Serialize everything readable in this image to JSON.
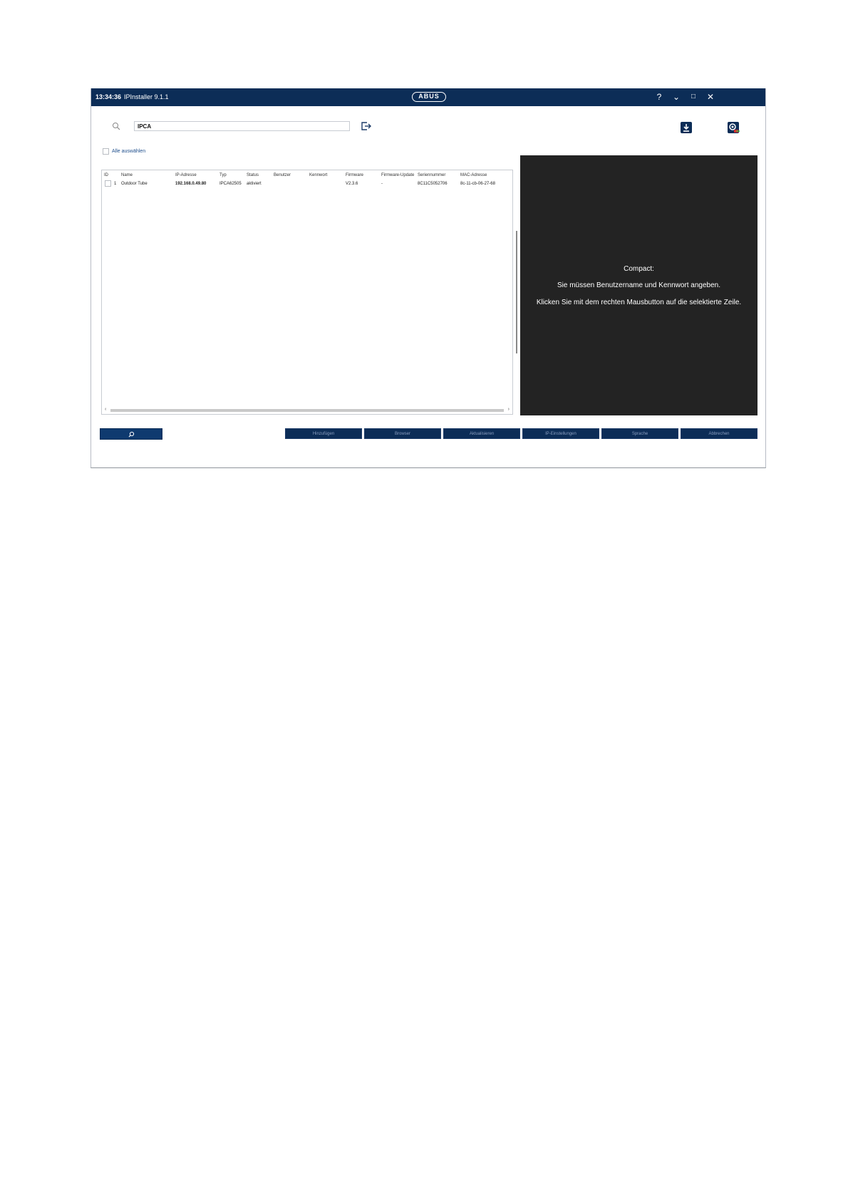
{
  "titlebar": {
    "time": "13:34:36",
    "title": "IPInstaller 9.1.1",
    "logo": "ABUS",
    "help": "?",
    "minimize": "⌄",
    "maximize": "□",
    "close": "✕"
  },
  "search": {
    "value": "IPCA"
  },
  "select_all_label": "Alle auswählen",
  "table": {
    "columns": [
      "ID",
      "Name",
      "IP-Adresse",
      "Typ",
      "Status",
      "Benutzer",
      "Kennwort",
      "Firmware",
      "Firmware-Update",
      "Seriennummer",
      "MAC-Adresse"
    ],
    "rows": [
      [
        "1",
        "Outdoor Tube",
        "192.168.0.49.80",
        "IPCA62505",
        "aktiviert",
        "",
        "",
        "V2.3.6",
        "-",
        "8C11C5052706",
        "8c-11-cb-06-27-68"
      ]
    ]
  },
  "preview": {
    "line1": "Compact:",
    "line2": "Sie müssen Benutzername und Kennwort angeben.",
    "line3": "Klicken Sie mit dem rechten Mausbutton auf die selektierte Zeile."
  },
  "buttons": [
    "Hinzufügen",
    "Browser",
    "Aktualisieren",
    "IP-Einstellungen",
    "Sprache",
    "Abbrechen"
  ],
  "icons": {
    "search": "search-icon",
    "export": "export-icon",
    "download": "download-icon",
    "camera_settings": "camera-settings-icon"
  },
  "colors": {
    "titlebar": "#0c2d57",
    "preview_bg": "#232323"
  }
}
